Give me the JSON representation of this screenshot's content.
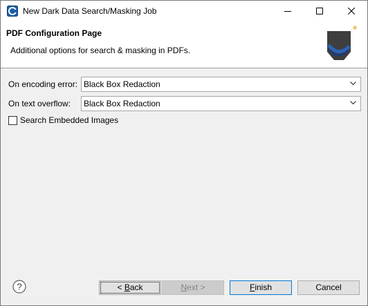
{
  "window": {
    "title": "New Dark Data Search/Masking Job",
    "app_icon": "app-logo-icon",
    "controls": [
      "minimize-icon",
      "maximize-icon",
      "close-icon"
    ]
  },
  "banner": {
    "title": "PDF Configuration Page",
    "description": "Additional options for search & masking in PDFs.",
    "graphic": "wizard-banner-icon"
  },
  "form": {
    "encoding_error": {
      "label": "On encoding error:",
      "value": "Black Box Redaction"
    },
    "text_overflow": {
      "label": "On text overflow:",
      "value": "Black Box Redaction"
    },
    "search_embedded_images": {
      "label": "Search Embedded Images",
      "checked": false
    }
  },
  "footer": {
    "help_icon": "help-icon",
    "back_prefix": "< ",
    "back_mnemonic": "B",
    "back_rest": "ack",
    "next_mnemonic": "N",
    "next_rest": "ext >",
    "finish_mnemonic": "F",
    "finish_rest": "inish",
    "cancel_label": "Cancel"
  },
  "colors": {
    "accent": "#0078d7",
    "window_bg": "#f0f0f0",
    "disabled_text": "#838383"
  }
}
